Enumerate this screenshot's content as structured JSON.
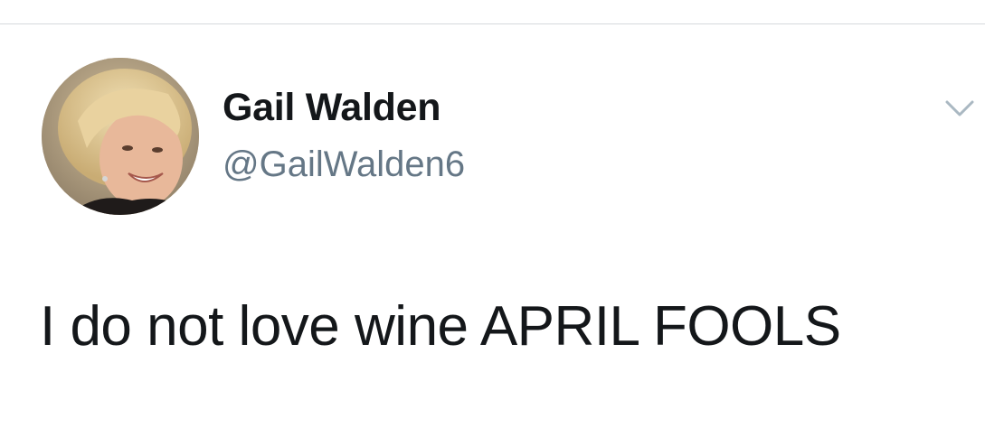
{
  "tweet": {
    "author": {
      "display_name": "Gail Walden",
      "handle": "@GailWalden6",
      "avatar_icon": "profile-photo"
    },
    "text": "I do not love wine APRIL FOOLS",
    "menu_icon": "chevron-down-icon"
  },
  "colors": {
    "name": "#14171a",
    "handle": "#657786",
    "text": "#14171a",
    "chevron": "#aab8c2",
    "divider": "#d6d9dc"
  }
}
